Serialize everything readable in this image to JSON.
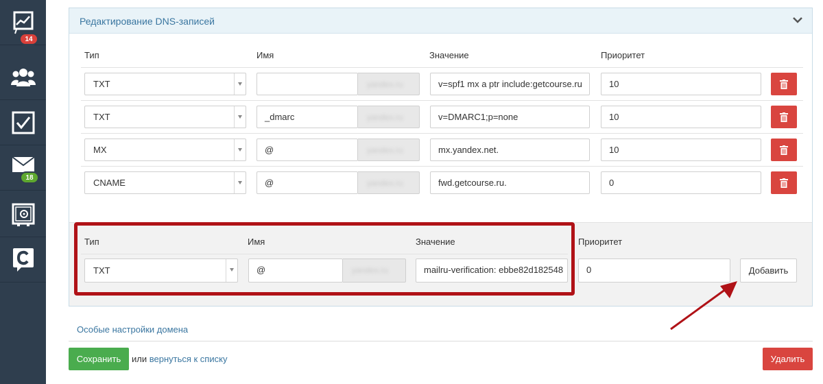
{
  "sidebar": {
    "items": [
      {
        "icon": "chart-icon",
        "badge": "14",
        "badge_color": "#d9403a"
      },
      {
        "icon": "users-icon"
      },
      {
        "icon": "checkbox-icon"
      },
      {
        "icon": "mail-icon",
        "badge": "18",
        "badge_color": "#5ea82f"
      },
      {
        "icon": "safe-icon"
      },
      {
        "icon": "getcourse-logo-icon"
      }
    ]
  },
  "panel": {
    "title": "Редактирование DNS-записей",
    "headers": {
      "type": "Тип",
      "name": "Имя",
      "value": "Значение",
      "priority": "Приоритет"
    },
    "records": [
      {
        "type": "TXT",
        "name": "",
        "domain": "yandex.ru",
        "value": "v=spf1 mx a ptr include:getcourse.ru",
        "priority": "10"
      },
      {
        "type": "TXT",
        "name": "_dmarc",
        "domain": "yandex.ru",
        "value": "v=DMARC1;p=none",
        "priority": "10"
      },
      {
        "type": "MX",
        "name": "@",
        "domain": "yandex.ru",
        "value": "mx.yandex.net.",
        "priority": "10"
      },
      {
        "type": "CNAME",
        "name": "@",
        "domain": "yandex.ru",
        "value": "fwd.getcourse.ru.",
        "priority": "0"
      }
    ],
    "new_record": {
      "headers": {
        "type": "Тип",
        "name": "Имя",
        "value": "Значение",
        "priority": "Приоритет"
      },
      "type": "TXT",
      "name": "@",
      "domain": "yandex.ru",
      "value": "mailru-verification: ebbe82d182548",
      "priority": "0",
      "add_label": "Добавить"
    }
  },
  "footer": {
    "special_settings": "Особые настройки домена",
    "save_label": "Сохранить",
    "or_text": "или",
    "back_link": "вернуться к списку",
    "delete_label": "Удалить"
  },
  "colors": {
    "sidebar": "#2f3e4e",
    "danger": "#d9453f",
    "success": "#4aac4e",
    "link": "#3a76a0",
    "highlight": "#b01217"
  }
}
